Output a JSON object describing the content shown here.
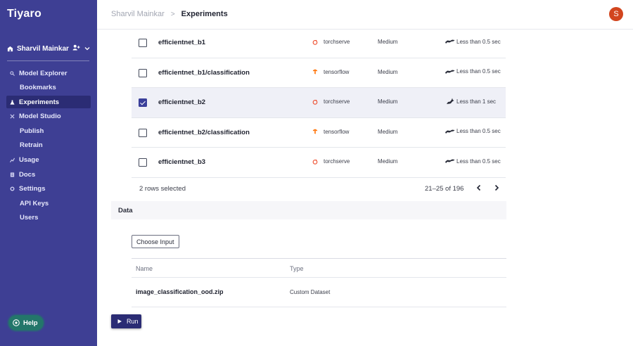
{
  "app": {
    "brand": "Tiyaro"
  },
  "sidebar": {
    "account_name": "Sharvil Mainkar",
    "items": [
      {
        "label": "Model Explorer",
        "icon": "search-icon",
        "sub": false,
        "active": false
      },
      {
        "label": "Bookmarks",
        "icon": "",
        "sub": true,
        "active": false
      },
      {
        "label": "Experiments",
        "icon": "flask-icon",
        "sub": false,
        "active": true
      },
      {
        "label": "Model Studio",
        "icon": "tools-icon",
        "sub": false,
        "active": false
      },
      {
        "label": "Publish",
        "icon": "",
        "sub": true,
        "active": false
      },
      {
        "label": "Retrain",
        "icon": "",
        "sub": true,
        "active": false
      },
      {
        "label": "Usage",
        "icon": "chart-icon",
        "sub": false,
        "active": false
      },
      {
        "label": "Docs",
        "icon": "doc-icon",
        "sub": false,
        "active": false
      },
      {
        "label": "Settings",
        "icon": "gear-icon",
        "sub": false,
        "active": false
      },
      {
        "label": "API Keys",
        "icon": "",
        "sub": true,
        "active": false
      },
      {
        "label": "Users",
        "icon": "",
        "sub": true,
        "active": false
      }
    ],
    "help_label": "Help"
  },
  "header": {
    "breadcrumb_parent": "Sharvil Mainkar",
    "breadcrumb_separator": ">",
    "breadcrumb_current": "Experiments",
    "avatar_initial": "S"
  },
  "table": {
    "rows": [
      {
        "model": "efficientnet_b1",
        "framework": "torchserve",
        "framework_icon": "torchserve-icon",
        "size": "Medium",
        "latency": "Less than 0.5 sec",
        "latency_icon": "cheetah-icon",
        "checked": false
      },
      {
        "model": "efficientnet_b1/classification",
        "framework": "tensorflow",
        "framework_icon": "tensorflow-icon",
        "size": "Medium",
        "latency": "Less than 0.5 sec",
        "latency_icon": "cheetah-icon",
        "checked": false
      },
      {
        "model": "efficientnet_b2",
        "framework": "torchserve",
        "framework_icon": "torchserve-icon",
        "size": "Medium",
        "latency": "Less than 1 sec",
        "latency_icon": "rabbit-icon",
        "checked": true
      },
      {
        "model": "efficientnet_b2/classification",
        "framework": "tensorflow",
        "framework_icon": "tensorflow-icon",
        "size": "Medium",
        "latency": "Less than 0.5 sec",
        "latency_icon": "cheetah-icon",
        "checked": false
      },
      {
        "model": "efficientnet_b3",
        "framework": "torchserve",
        "framework_icon": "torchserve-icon",
        "size": "Medium",
        "latency": "Less than 0.5 sec",
        "latency_icon": "cheetah-icon",
        "checked": false
      }
    ],
    "selected_text": "2 rows selected",
    "range_text": "21–25 of 196"
  },
  "data_section": {
    "title": "Data",
    "choose_input_label": "Choose Input",
    "columns": {
      "name": "Name",
      "type": "Type"
    },
    "files": [
      {
        "name": "image_classification_ood.zip",
        "type": "Custom Dataset"
      }
    ]
  },
  "actions": {
    "run_label": "Run"
  },
  "colors": {
    "sidebar_bg": "#3e3f94",
    "accent": "#2b2c74",
    "avatar": "#d2451e",
    "help": "#23766a",
    "torchserve": "#ee4c2c",
    "tensorflow": "#ff6f00"
  }
}
